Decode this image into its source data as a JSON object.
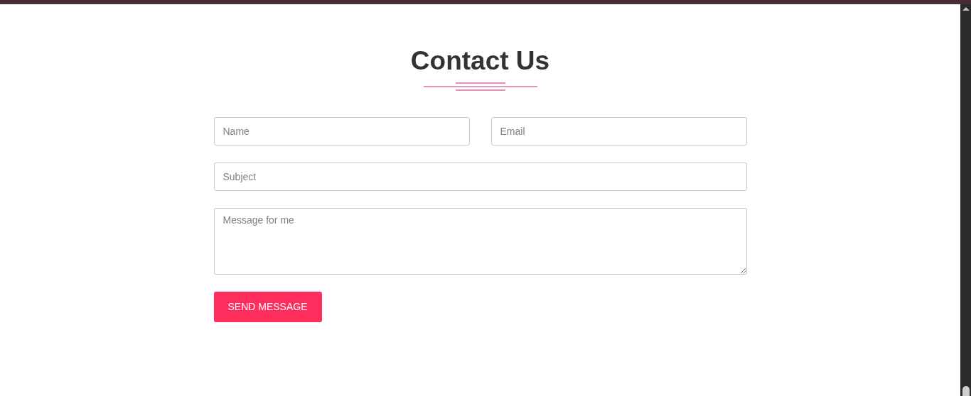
{
  "heading": "Contact Us",
  "fields": [
    {
      "kind": "input",
      "placeholder": "Name"
    },
    {
      "kind": "input",
      "placeholder": "Email"
    },
    {
      "kind": "input",
      "placeholder": "Subject"
    },
    {
      "kind": "textarea",
      "placeholder": "Message for me"
    }
  ],
  "submit_button": "SEND MESSAGE"
}
